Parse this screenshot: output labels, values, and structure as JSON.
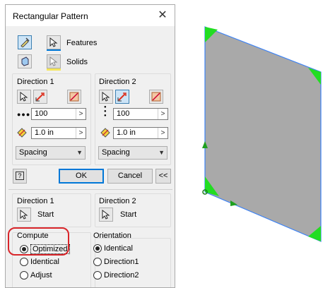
{
  "dialog": {
    "title": "Rectangular Pattern",
    "close_glyph": "✕",
    "features_label": "Features",
    "solids_label": "Solids",
    "direction1": {
      "title": "Direction 1",
      "count": "100",
      "spacing": "1.0 in",
      "method": "Spacing",
      "arrow": ">"
    },
    "direction2": {
      "title": "Direction 2",
      "count": "100",
      "spacing": "1.0 in",
      "method": "Spacing",
      "arrow": ">"
    },
    "help_glyph": "?",
    "ok_label": "OK",
    "cancel_label": "Cancel",
    "more_label": "<<",
    "start1": {
      "title": "Direction 1",
      "label": "Start"
    },
    "start2": {
      "title": "Direction 2",
      "label": "Start"
    },
    "compute": {
      "title": "Compute",
      "options": [
        "Optimized",
        "Identical",
        "Adjust"
      ],
      "selected": "Optimized"
    },
    "orientation": {
      "title": "Orientation",
      "options": [
        "Identical",
        "Direction1",
        "Direction2"
      ],
      "selected": "Identical"
    }
  },
  "colors": {
    "accent": "#0078d7",
    "highlight_ring": "#d9252a",
    "part_face": "#a9a9a9",
    "part_edge": "#3b82f6",
    "corner_green": "#22dd22"
  }
}
